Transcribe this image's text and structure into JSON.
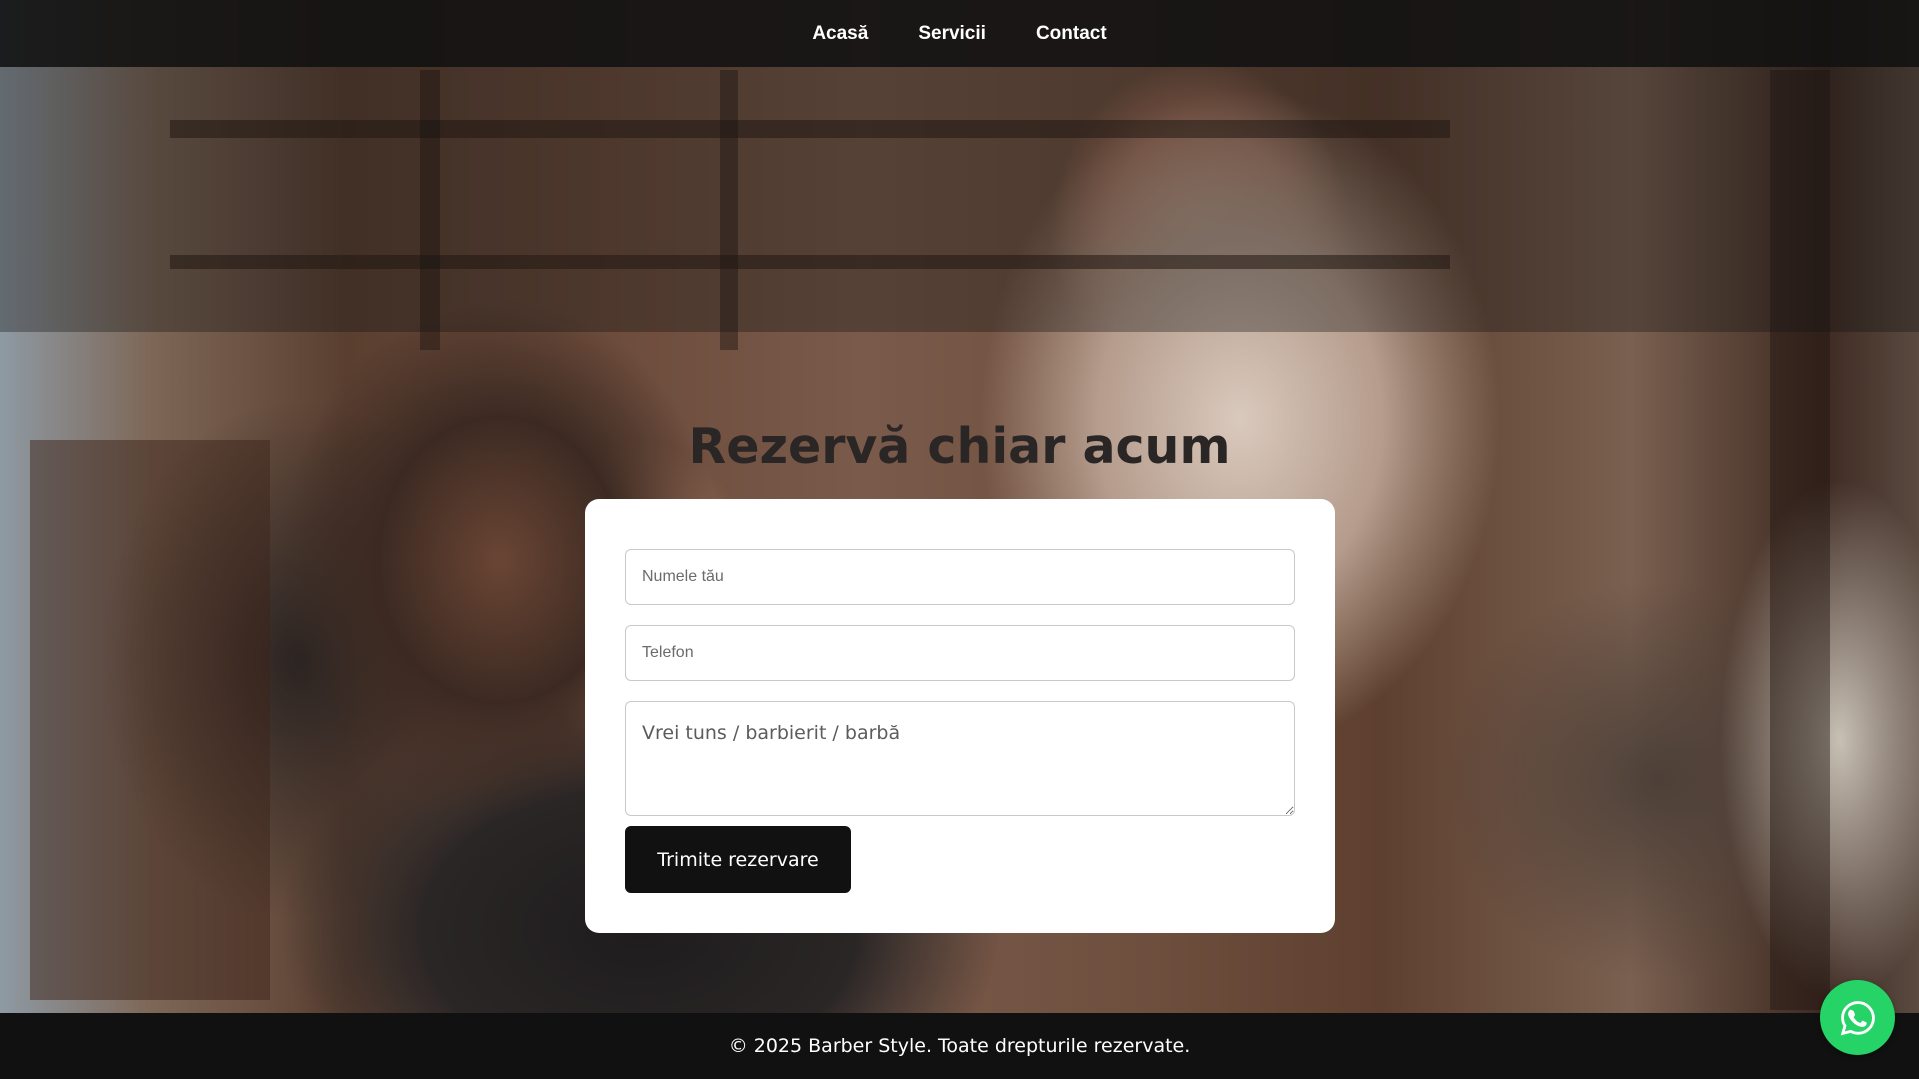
{
  "nav": {
    "items": [
      {
        "label": "Acasă"
      },
      {
        "label": "Servicii"
      },
      {
        "label": "Contact"
      }
    ]
  },
  "hero": {
    "title": "Rezervă chiar acum"
  },
  "form": {
    "name_placeholder": "Numele tău",
    "phone_placeholder": "Telefon",
    "service_placeholder": "Vrei tuns / barbierit / barbă",
    "submit_label": "Trimite rezervare"
  },
  "footer": {
    "text": "© 2025 Barber Style. Toate drepturile rezervate."
  },
  "floating": {
    "icon": "whatsapp-icon",
    "color": "#25d366"
  }
}
